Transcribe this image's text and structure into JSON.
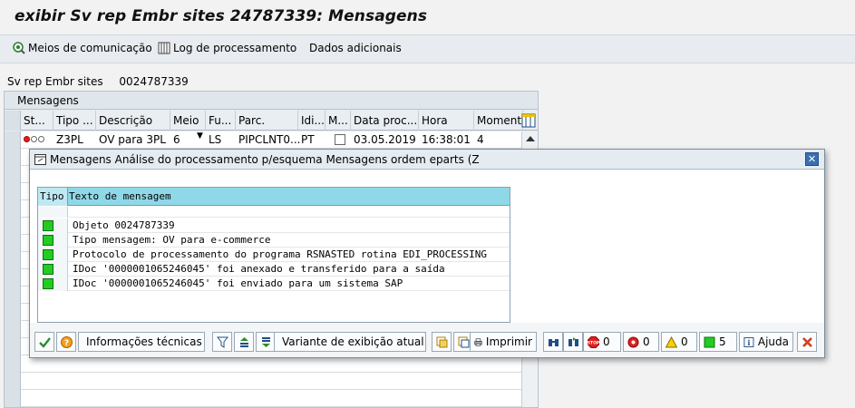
{
  "window": {
    "title": "exibir Sv rep Embr sites 24787339: Mensagens"
  },
  "toolbar": {
    "means_label": "Meios de comunicação",
    "log_label": "Log de processamento",
    "extra_label": "Dados adicionais"
  },
  "header_field": {
    "label": "Sv rep Embr sites",
    "value": "0024787339"
  },
  "grid": {
    "title": "Mensagens",
    "columns": [
      "St...",
      "Tipo ...",
      "Descrição",
      "Meio",
      "Fu...",
      "Parc.",
      "Idi...",
      "M...",
      "Data proc...",
      "Hora",
      "Momento"
    ],
    "rows": [
      {
        "tipo": "Z3PL",
        "descricao": "OV para 3PL",
        "meio": "6",
        "funcao": "LS",
        "parceiro": "PIPCLNT0...",
        "idioma": "PT",
        "data": "03.05.2019",
        "hora": "16:38:01",
        "momento": "4"
      }
    ]
  },
  "dialog": {
    "title": "Mensagens Análise do processamento p/esquema Mensagens ordem eparts (Z",
    "close_symbol": "✕",
    "table_headers": {
      "tipo": "Tipo",
      "texto": "Texto de mensagem"
    },
    "messages": [
      {
        "type": "success",
        "text": "Objeto 0024787339"
      },
      {
        "type": "success",
        "text": "Tipo mensagem: OV para e-commerce"
      },
      {
        "type": "success",
        "text": "Protocolo de processamento do programa RSNASTED rotina EDI_PROCESSING"
      },
      {
        "type": "success",
        "text": "IDoc '0000001065246045' foi anexado e transferido para a saída"
      },
      {
        "type": "success",
        "text": "IDoc '0000001065246045' foi enviado para um sistema SAP"
      }
    ],
    "footer": {
      "tech_info_label": "Informações técnicas",
      "layout_label": "Variante de exibição atual",
      "print_label": "Imprimir",
      "stop_count": "0",
      "error_count": "0",
      "warning_count": "0",
      "success_count": "5",
      "help_label": "Ajuda"
    }
  },
  "colors": {
    "success": "#22cc22",
    "error": "#e02020",
    "warning": "#f0c000",
    "header_band": "#8fd8e8"
  }
}
